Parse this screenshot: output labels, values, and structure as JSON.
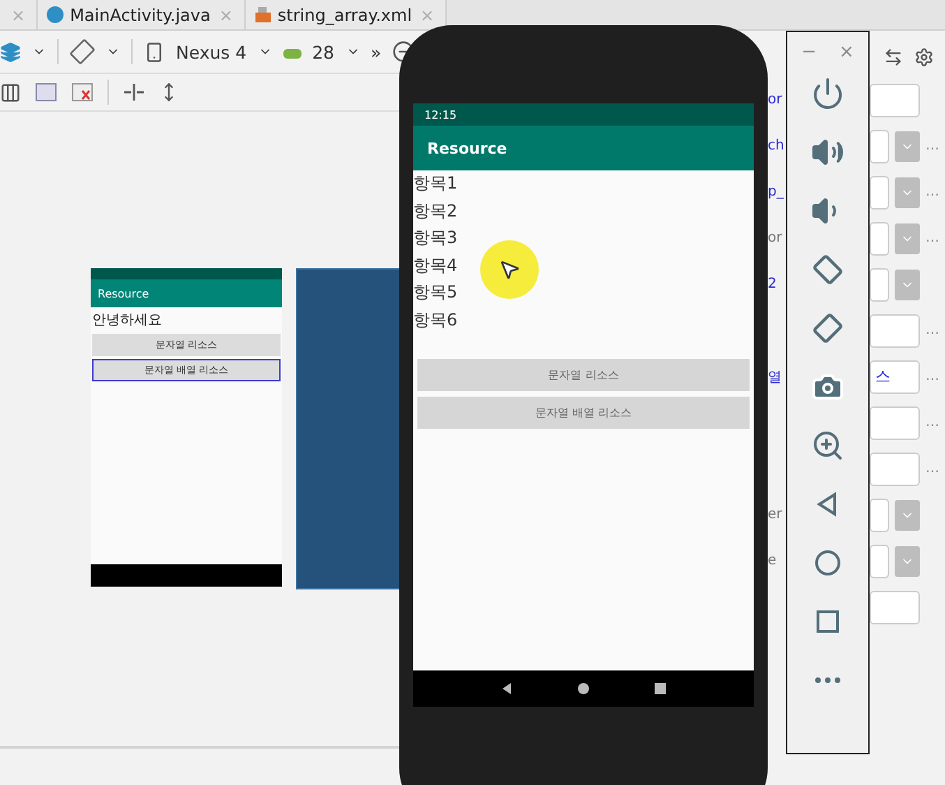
{
  "editor_tabs": [
    {
      "label": "MainActivity.java",
      "kind": "java"
    },
    {
      "label": "string_array.xml",
      "kind": "xml"
    }
  ],
  "tab_close": "×",
  "toolbar": {
    "device": "Nexus 4",
    "api": "28",
    "overflow": "»"
  },
  "design_preview": {
    "app_title": "Resource",
    "label": "안녕하세요",
    "buttons": [
      {
        "label": "문자열 리소스",
        "selected": false
      },
      {
        "label": "문자열 배열 리소스",
        "selected": true
      }
    ]
  },
  "properties": [
    {
      "label": "or",
      "kind": "text",
      "link": true
    },
    {
      "label": "ch",
      "kind": "dropdown",
      "link": true,
      "more": "…"
    },
    {
      "label": "p_",
      "kind": "dropdown",
      "link": true,
      "more": "…"
    },
    {
      "label": "or",
      "kind": "dropdown",
      "link": false,
      "more": "…"
    },
    {
      "label": "2",
      "kind": "dropdown",
      "link": true
    },
    {
      "kind": "text",
      "more": "…"
    },
    {
      "label": "열",
      "kind": "text",
      "link": true,
      "value": "스",
      "more": "…"
    },
    {
      "kind": "text",
      "more": "…"
    },
    {
      "kind": "text",
      "more": "…"
    },
    {
      "label": "er",
      "kind": "dropdown",
      "link": false
    },
    {
      "label": "e",
      "kind": "dropdown",
      "link": false
    },
    {
      "kind": "text"
    }
  ],
  "emulator": {
    "time": "12:15",
    "app_title": "Resource",
    "items": [
      "항목1",
      "항목2",
      "항목3",
      "항목4",
      "항목5",
      "항목6"
    ],
    "buttons": [
      "문자열 리소스",
      "문자열 배열 리소스"
    ]
  },
  "emulator_controls": {
    "minimize": "−",
    "close": "×"
  }
}
